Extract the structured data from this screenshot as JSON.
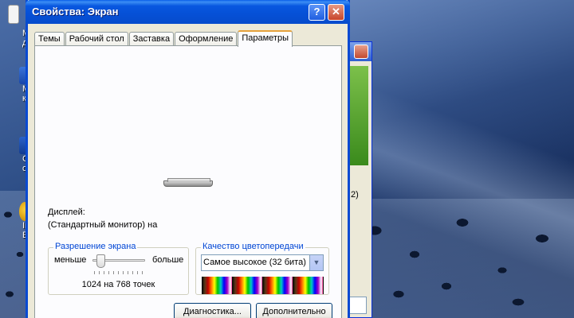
{
  "window": {
    "title": "Свойства: Экран",
    "help_button": "?",
    "close_button": "✕"
  },
  "tabs": [
    {
      "label": "Темы"
    },
    {
      "label": "Рабочий стол"
    },
    {
      "label": "Заставка"
    },
    {
      "label": "Оформление"
    },
    {
      "label": "Параметры",
      "active": true
    }
  ],
  "display": {
    "label": "Дисплей:",
    "value": "(Стандартный монитор) на"
  },
  "resolution": {
    "group_title": "Разрешение экрана",
    "less_label": "меньше",
    "more_label": "больше",
    "value_text": "1024 на 768 точек"
  },
  "color_quality": {
    "group_title": "Качество цветопередачи",
    "selected": "Самое высокое (32 бита)"
  },
  "buttons": {
    "diagnostics": "Диагностика...",
    "advanced": "Дополнительно"
  },
  "desktop_icons": [
    {
      "label": "М\nдоку",
      "icon": "my-documents-icon"
    },
    {
      "label": "М\nкомп",
      "icon": "my-computer-icon"
    },
    {
      "label": "Сет\nокру",
      "icon": "network-places-icon"
    },
    {
      "label": "Inte\nExp",
      "icon": "internet-explorer-icon"
    }
  ],
  "background_window": {
    "text": "2)"
  },
  "colors": {
    "titlebar": "#0a5fe8",
    "window_body": "#ece9d8",
    "group_title": "#0046d5"
  }
}
